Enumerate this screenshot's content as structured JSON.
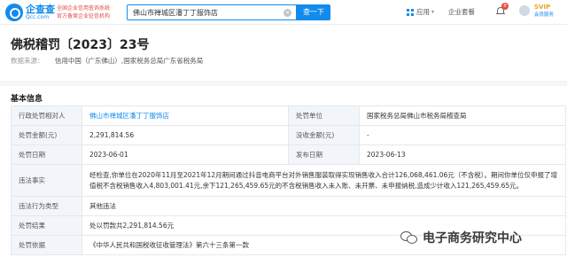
{
  "header": {
    "logo_cn": "企查查",
    "logo_en": "Qcc.com",
    "slogan_line1": "全国企业信用查询系统",
    "slogan_line2": "官方备案企业征信机构",
    "search_value": "佛山市禅城区潘丁丁服饰店",
    "search_button": "查一下",
    "nav_apps": "应用",
    "nav_bid": "企业套餐",
    "notification_count": "8",
    "svip_label": "SVIP",
    "svip_sub": "会员服务"
  },
  "page": {
    "title": "佛税稽罚〔2023〕23号",
    "source_label": "数据来源：",
    "source_value": "信用中国（广东佛山）,国家税务总局广东省税务局"
  },
  "section": {
    "title": "基本信息"
  },
  "table": {
    "target_label": "行政处罚相对人",
    "target_value": "佛山市禅城区潘丁丁服饰店",
    "unit_label": "处罚单位",
    "unit_value": "国家税务总局佛山市税务局稽查局",
    "amount_label": "处罚金额(元)",
    "amount_value": "2,291,814.56",
    "confiscate_label": "没收金额(元)",
    "confiscate_value": "-",
    "date_label": "处罚日期",
    "date_value": "2023-06-01",
    "publish_label": "发布日期",
    "publish_value": "2023-06-13",
    "facts_label": "违法事实",
    "facts_value": "经检查,你单位在2020年11月至2021年12月期间通过抖音电商平台对外销售服装取得实现销售收入合计126,068,461.06元（不含税）。期间你单位仅申报了增值税不含税销售收入4,803,001.41元,余下121,265,459.65元的不含税销售收入未入账、未开票、未申报纳税,造成少计收入121,265,459.65元。",
    "type_label": "违法行为类型",
    "type_value": "其他违法",
    "result_label": "处罚结果",
    "result_value": "处以罚款共2,291,814.56元",
    "basis_label": "处罚依据",
    "basis_value": "《中华人民共和国税收征收管理法》第六十三条第一款"
  },
  "watermark": {
    "text": "电子商务研究中心"
  },
  "colors": {
    "brand": "#128bed",
    "label_bg": "#f2f6fb",
    "border": "#e4e8ee"
  }
}
